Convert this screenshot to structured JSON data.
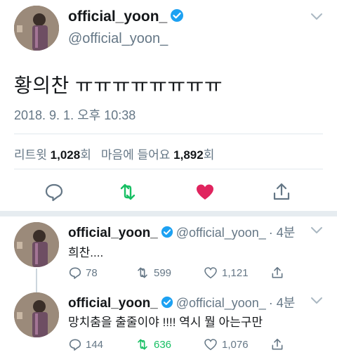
{
  "tweet": {
    "name": "official_yoon_",
    "handle": "@official_yoon_",
    "text": "황의찬 ㅠㅠㅠㅠㅠㅠㅠㅠ",
    "timestamp": "2018. 9. 1. 오후 10:38",
    "retweet_label": "리트윗",
    "retweet_count": "1,028",
    "retweet_unit": "회",
    "like_label": "마음에 들어요",
    "like_count": "1,892",
    "like_unit": "회"
  },
  "replies": [
    {
      "name": "official_yoon_",
      "handle": "@official_yoon_",
      "time": "· 4분",
      "text": "희찬....",
      "reply_count": "78",
      "retweet_count": "599",
      "like_count": "1,121"
    },
    {
      "name": "official_yoon_",
      "handle": "@official_yoon_",
      "time": "· 4분",
      "text": "망치춤을 출줄이야 !!!! 역시 뭘 아는구만",
      "reply_count": "144",
      "retweet_count": "636",
      "like_count": "1,076"
    }
  ],
  "icons": {
    "reply": "reply-icon",
    "retweet": "retweet-icon",
    "like": "heart-icon",
    "share": "share-icon",
    "verified": "verified-badge-icon",
    "menu": "chevron-down-icon"
  },
  "colors": {
    "verified": "#1da1f2",
    "retweet_active": "#17bf63",
    "like_active": "#e0245e",
    "muted": "#657786"
  }
}
